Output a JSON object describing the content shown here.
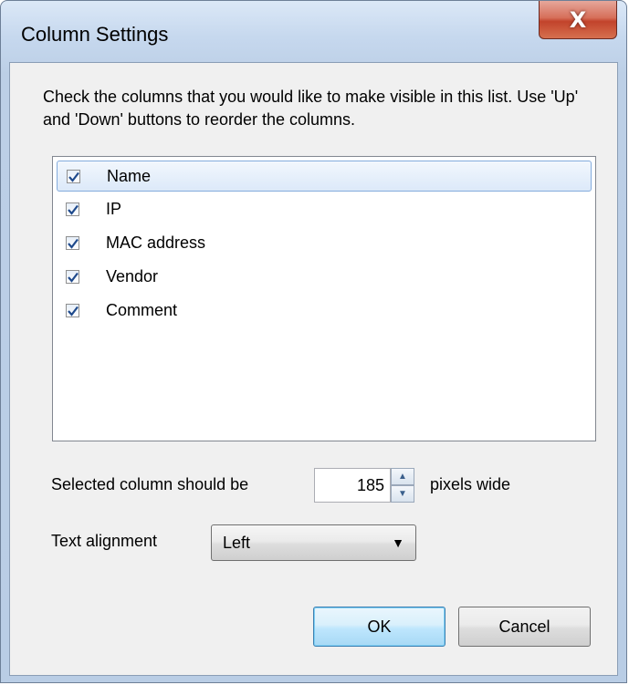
{
  "window": {
    "title": "Column Settings",
    "close_glyph": "X"
  },
  "instructions": "Check the columns that you would like to make visible in this list. Use 'Up' and 'Down' buttons to reorder the columns.",
  "columns": [
    {
      "label": "Name",
      "checked": true,
      "selected": true
    },
    {
      "label": "IP",
      "checked": true,
      "selected": false
    },
    {
      "label": "MAC address",
      "checked": true,
      "selected": false
    },
    {
      "label": "Vendor",
      "checked": true,
      "selected": false
    },
    {
      "label": "Comment",
      "checked": true,
      "selected": false
    }
  ],
  "width_row": {
    "prefix": "Selected column should be",
    "value": "185",
    "suffix": "pixels wide"
  },
  "alignment_row": {
    "label": "Text alignment",
    "selected": "Left"
  },
  "buttons": {
    "ok": "OK",
    "cancel": "Cancel"
  },
  "colors": {
    "accent": "#3c7fb1",
    "close": "#c2432b",
    "checkmark": "#1f4a8c"
  },
  "icons": {
    "close": "close-icon",
    "check": "checkmark-icon",
    "spin_up": "chevron-up-icon",
    "spin_down": "chevron-down-icon",
    "dropdown": "chevron-down-icon"
  }
}
